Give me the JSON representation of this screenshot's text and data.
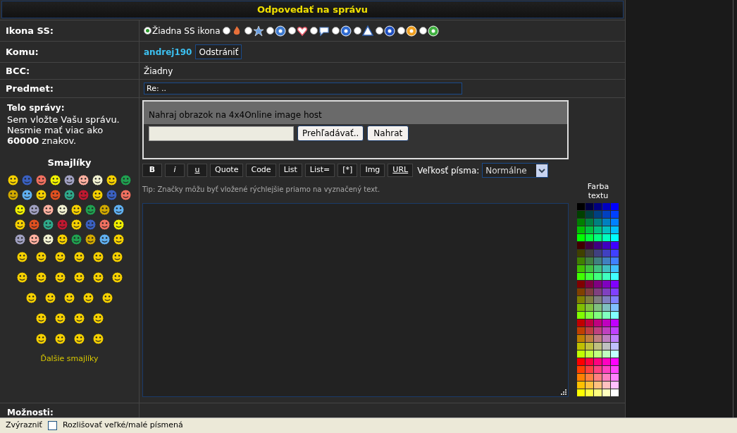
{
  "title": "Odpovedať na správu",
  "icon_row": {
    "label": "Ikona SS:",
    "options": [
      {
        "selected": true,
        "label": "Žiadna SS ikona"
      },
      {
        "selected": false
      },
      {
        "selected": false
      },
      {
        "selected": false
      },
      {
        "selected": false
      },
      {
        "selected": false
      },
      {
        "selected": false
      },
      {
        "selected": false
      },
      {
        "selected": false
      },
      {
        "selected": false
      },
      {
        "selected": false
      }
    ]
  },
  "to_row": {
    "label": "Komu:",
    "user": "andrej190",
    "remove_button": "Odstrániť"
  },
  "bcc_row": {
    "label": "BCC:",
    "value": "Žiadny"
  },
  "subject_row": {
    "label": "Predmet:",
    "value": "Re: .."
  },
  "body_row": {
    "label": "Telo správy:",
    "hint": "Sem vložte Vašu správu.",
    "limit": "Nesmie mať viac ako **60000** znakov.",
    "smileys_title": "Smajlíky",
    "more_smileys": "Ďalšie smajlíky",
    "upload": {
      "caption": "Nahraj obrazok na 4x4Online image host",
      "browse_button": "Prehľadávať..",
      "upload_button": "Nahrat"
    },
    "format_buttons": [
      {
        "label": "B",
        "kind": "bold"
      },
      {
        "label": "i",
        "kind": "italic"
      },
      {
        "label": "u",
        "kind": "underline"
      },
      {
        "label": "Quote",
        "kind": "plain"
      },
      {
        "label": "Code",
        "kind": "plain"
      },
      {
        "label": "List",
        "kind": "plain"
      },
      {
        "label": "List=",
        "kind": "plain"
      },
      {
        "label": "[*]",
        "kind": "plain"
      },
      {
        "label": "Img",
        "kind": "plain"
      },
      {
        "label": "URL",
        "kind": "underline"
      }
    ],
    "font_size_label": "Veľkosť písma:",
    "font_size_value": "Normálne",
    "tip": "Tip: Značky môžu byť vložené rýchlejšie priamo na vyznačený text.",
    "color_label": "Farba textu"
  },
  "options_row": {
    "label": "Možnosti:"
  },
  "find_bar": {
    "highlight": "Zvýrazniť",
    "match_case": {
      "label": "Rozlišovať veľké/malé písmená",
      "checked": false
    }
  }
}
